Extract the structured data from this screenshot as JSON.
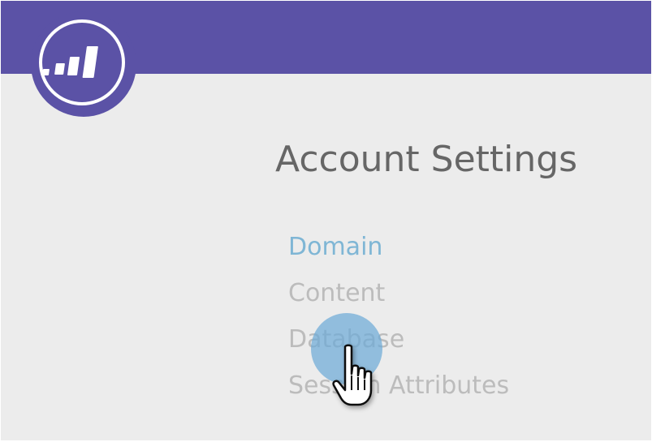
{
  "app": {
    "logo_icon": "marketo-bars-logo-icon",
    "header_color": "#5b52a6"
  },
  "main": {
    "title": "Account Settings"
  },
  "nav": {
    "items": [
      {
        "label": "Domain",
        "state": "active",
        "color": "#7fb6d5"
      },
      {
        "label": "Content",
        "state": "inactive",
        "color": "#bcbcbc"
      },
      {
        "label": "Database",
        "state": "inactive",
        "color": "#bcbcbc"
      },
      {
        "label": "Session Attributes",
        "state": "inactive",
        "color": "#bcbcbc"
      }
    ]
  },
  "cursor": {
    "icon": "hand-pointer-icon",
    "effect": "click-ripple"
  }
}
